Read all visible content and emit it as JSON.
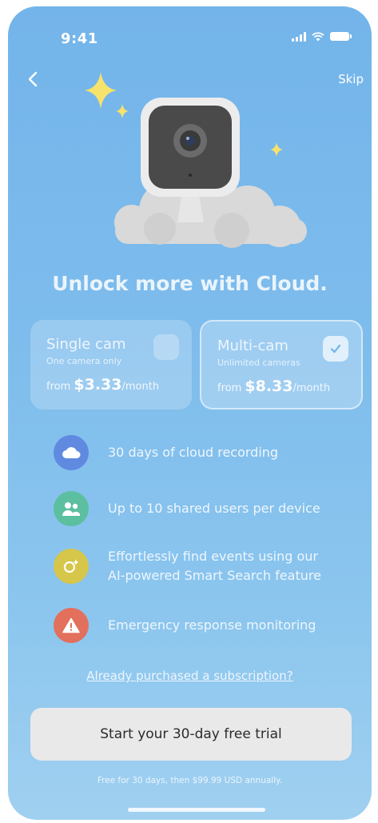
{
  "status_bar": {
    "time": "9:41"
  },
  "nav": {
    "back_icon": "chevron-left-icon",
    "skip_label": "Skip"
  },
  "headline": "Unlock more with Cloud.",
  "plans": [
    {
      "name": "Single cam",
      "subtitle": "One camera only",
      "price_prefix": "from ",
      "price": "$3.33",
      "price_suffix": "/month",
      "selected": false
    },
    {
      "name": "Multi-cam",
      "subtitle": "Unlimited cameras",
      "price_prefix": "from ",
      "price": "$8.33",
      "price_suffix": "/month",
      "selected": true
    }
  ],
  "features": [
    {
      "icon": "cloud-icon",
      "color": "#5f8ae0",
      "text": "30 days of cloud recording"
    },
    {
      "icon": "users-icon",
      "color": "#5cbfa0",
      "text": "Up to 10 shared users per device"
    },
    {
      "icon": "smart-search-icon",
      "color": "#d6c64a",
      "text": "Effortlessly find events using our AI-powered Smart Search feature"
    },
    {
      "icon": "warning-icon",
      "color": "#e2705c",
      "text": "Emergency response monitoring"
    }
  ],
  "purchased_link": "Already purchased a subscription?",
  "cta_label": "Start your 30-day free trial",
  "fine_print": "Free for 30 days, then $99.99 USD annually."
}
